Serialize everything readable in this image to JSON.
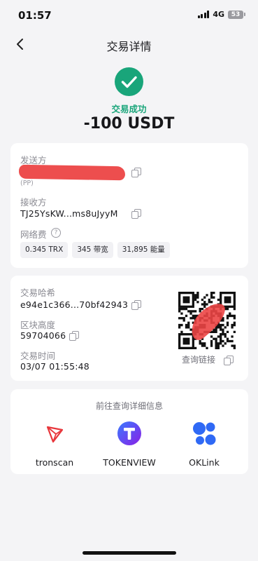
{
  "status_bar": {
    "time": "01:57",
    "network": "4G",
    "battery": "53"
  },
  "header": {
    "title": "交易详情"
  },
  "summary": {
    "status": "交易成功",
    "amount": "-100 USDT"
  },
  "card1": {
    "sender_label": "发送方",
    "sender_tag": "(PP)",
    "receiver_label": "接收方",
    "receiver_address": "TJ25YsKW...ms8uJyyM",
    "fee_label": "网络费",
    "fees": [
      "0.345 TRX",
      "345 带宽",
      "31,895 能量"
    ]
  },
  "card2": {
    "hash_label": "交易哈希",
    "hash": "e94e1c366...70bf42943",
    "block_label": "区块高度",
    "block": "59704066",
    "time_label": "交易时间",
    "time": "03/07 01:55:48",
    "qr_link": "查询链接"
  },
  "card3": {
    "title": "前往查询详细信息",
    "explorers": [
      "tronscan",
      "TOKENVIEW",
      "OKLink"
    ]
  },
  "colors": {
    "success": "#19a57a",
    "redaction": "#ec4545",
    "tron": "#e8373c",
    "tokenview": "#6a2bf0",
    "oklink": "#2f69f5"
  }
}
